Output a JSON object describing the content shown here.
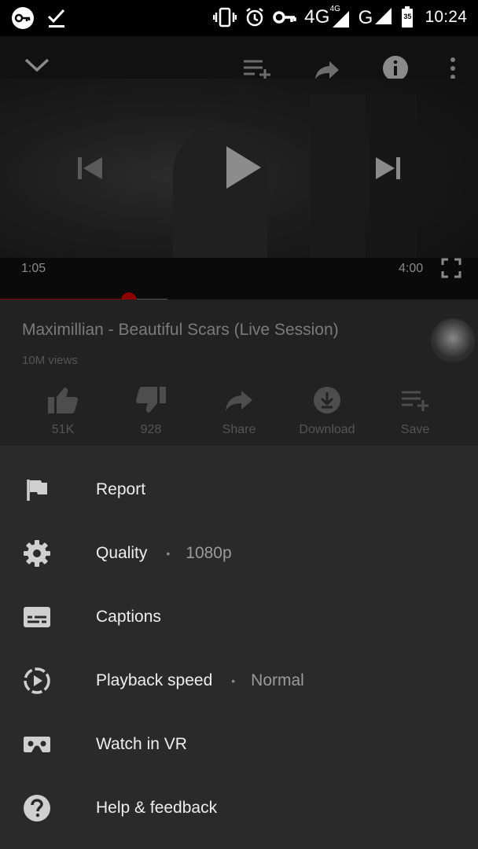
{
  "status_bar": {
    "network_4g": "4G",
    "network_4g_small": "4G",
    "network_g": "G",
    "battery_level": "35",
    "time": "10:24",
    "icons": [
      "vpn-key-icon",
      "check-icon",
      "vibrate-icon",
      "alarm-icon",
      "key-icon",
      "signal-icon",
      "battery-icon"
    ]
  },
  "player": {
    "elapsed": "1:05",
    "duration": "4:00",
    "progress": 0.27,
    "buffered": 0.35
  },
  "video": {
    "title": "Maximillian - Beautiful Scars (Live Session)",
    "views": "10M views"
  },
  "actions": [
    {
      "label": "51K",
      "icon": "thumbs-up-icon"
    },
    {
      "label": "928",
      "icon": "thumbs-down-icon"
    },
    {
      "label": "Share",
      "icon": "share-icon"
    },
    {
      "label": "Download",
      "icon": "download-icon"
    },
    {
      "label": "Save",
      "icon": "add-to-playlist-icon"
    }
  ],
  "menu": {
    "items": [
      {
        "label": "Report",
        "icon": "flag-icon"
      },
      {
        "label": "Quality",
        "icon": "gear-icon",
        "separator": "•",
        "value": "1080p"
      },
      {
        "label": "Captions",
        "icon": "captions-icon"
      },
      {
        "label": "Playback speed",
        "icon": "playback-speed-icon",
        "separator": "•",
        "value": "Normal"
      },
      {
        "label": "Watch in VR",
        "icon": "vr-headset-icon"
      },
      {
        "label": "Help & feedback",
        "icon": "help-icon"
      }
    ]
  },
  "colors": {
    "sheet_background": "#2a2a2a",
    "progress": "#8b0000"
  }
}
